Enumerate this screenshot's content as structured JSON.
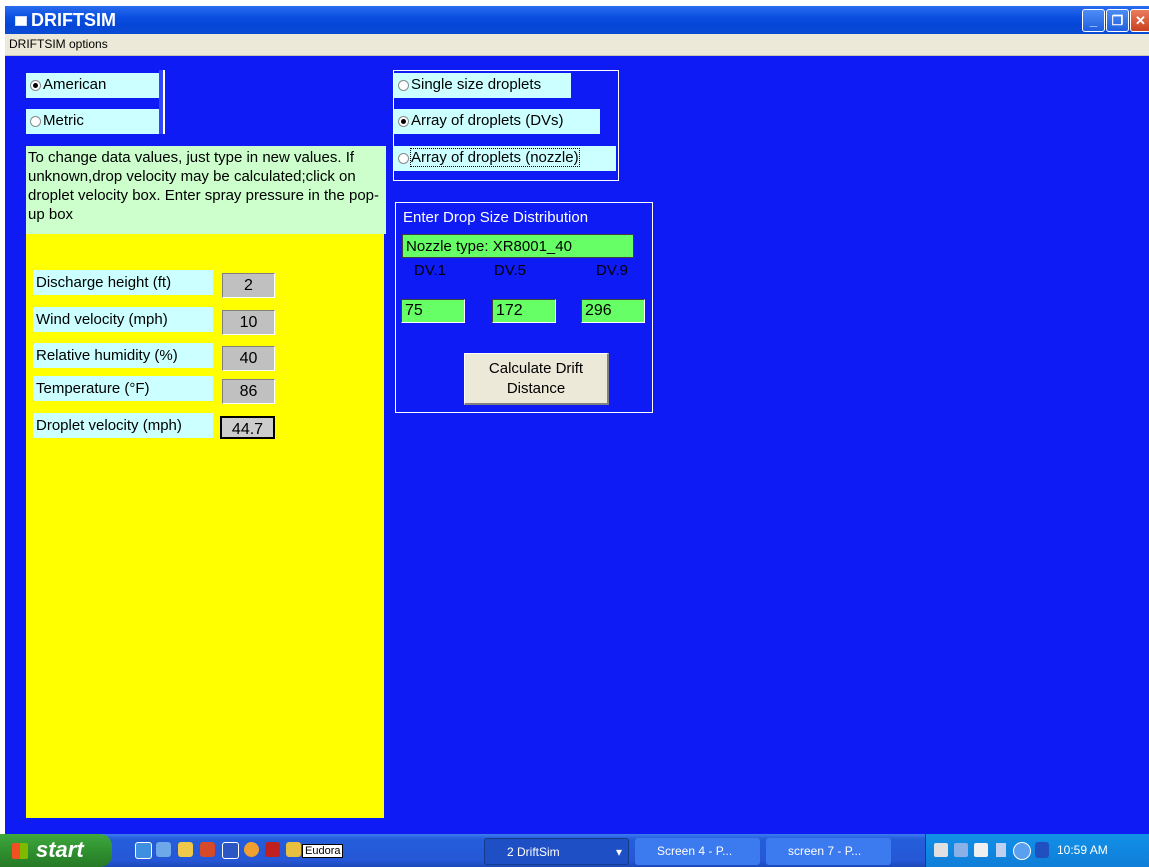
{
  "window": {
    "title": "DRIFTSIM",
    "menu": "DRIFTSIM options"
  },
  "units": {
    "options": [
      "American",
      "Metric"
    ],
    "selected": "American"
  },
  "droplet_mode": {
    "options": [
      "Single size droplets",
      "Array of droplets (DVs)",
      "Array of droplets (nozzle)"
    ],
    "selected": "Array of droplets (DVs)"
  },
  "instructions": "To change data values, just type in new values. If unknown,drop velocity may be calculated;click on droplet velocity box. Enter spray pressure in the pop-up box",
  "parameters": [
    {
      "label": "Discharge height (ft)",
      "value": "2"
    },
    {
      "label": "Wind velocity (mph)",
      "value": "10"
    },
    {
      "label": "Relative humidity (%)",
      "value": "40"
    },
    {
      "label": "Temperature (°F)",
      "value": "86"
    },
    {
      "label": "Droplet velocity (mph)",
      "value": "44.7"
    }
  ],
  "drop_distribution": {
    "heading": "Enter Drop Size Distribution",
    "nozzle_type": "Nozzle type: XR8001_40",
    "dv_labels": [
      "DV.1",
      "DV.5",
      "DV.9"
    ],
    "dv_values": [
      "75",
      "172",
      "296"
    ],
    "calculate_button": "Calculate Drift Distance"
  },
  "taskbar": {
    "start": "start",
    "quicklaunch_label": "Eudora",
    "tasks": [
      "2 DriftSim",
      "Screen 4 - P...",
      "screen 7 - P..."
    ],
    "clock": "10:59 AM"
  },
  "colors": {
    "client_bg": "#0f1bf5",
    "panel_yellow": "#ffff00",
    "label_cyan": "#ccffff",
    "input_green": "#66ff66"
  }
}
